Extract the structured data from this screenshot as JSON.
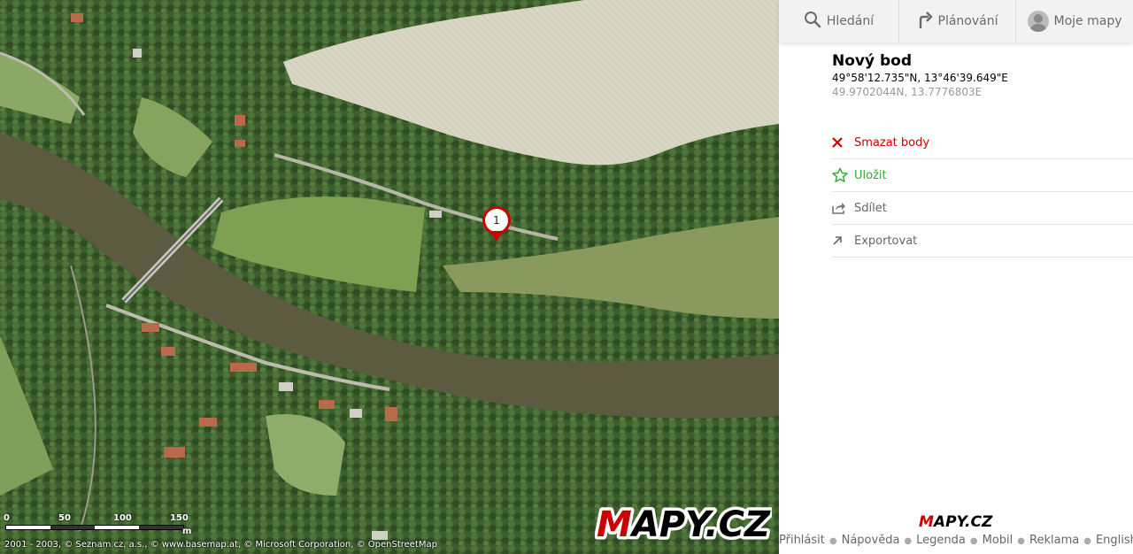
{
  "nav": {
    "search_label": "Hledání",
    "planning_label": "Plánování",
    "mymaps_label": "Moje mapy"
  },
  "poi": {
    "title": "Nový bod",
    "coords_dms": "49°58'12.735\"N, 13°46'39.649\"E",
    "coords_decimal": "49.9702044N, 13.7776803E"
  },
  "actions": {
    "delete_label": "Smazat body",
    "save_label": "Uložit",
    "share_label": "Sdílet",
    "export_label": "Exportovat"
  },
  "marker": {
    "number": "1"
  },
  "scale": {
    "labels": [
      "0",
      "50",
      "100",
      "150"
    ],
    "unit": "m"
  },
  "map_copyright": "2001 - 2003, © Seznam.cz, a.s., © www.basemap.at, © Microsoft Corporation, © OpenStreetMap",
  "logo_text": "MAPY.CZ",
  "footer": {
    "login": "Přihlásit",
    "help": "Nápověda",
    "legend": "Legenda",
    "mobile": "Mobil",
    "ads": "Reklama",
    "english": "English"
  },
  "colors": {
    "accent_red": "#cc0000",
    "save_green": "#33aa33",
    "nav_bg": "#f2f2f2"
  }
}
